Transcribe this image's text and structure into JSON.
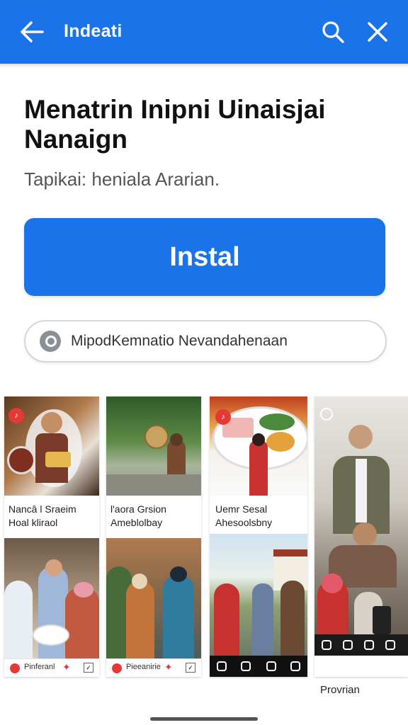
{
  "appbar": {
    "title": "Indeati",
    "back_icon": "arrow-left-icon",
    "search_icon": "search-icon",
    "close_icon": "close-icon",
    "color": "#1a73e8"
  },
  "main": {
    "title": "Menatrin Inipni Uinaisjai Nanaign",
    "subtitle": "Tapikai: heniala Ararian.",
    "install_label": "Instal",
    "search_text": "MipodKemnatio Nevandahenaan"
  },
  "gallery": {
    "cards": [
      {
        "caption_line1": "Nancâ l Sraeim",
        "caption_line2": "Hoal kliraol",
        "badge": "♪"
      },
      {
        "caption_line1": "l'aora Grsion",
        "caption_line2": "Ameblolbay",
        "badge": ""
      },
      {
        "caption_line1": "Uemr Sesal",
        "caption_line2": "Ahesoolsbny",
        "badge": "♪"
      },
      {
        "caption_line1": "Provrian",
        "caption_line2": "",
        "badge": ""
      }
    ],
    "footer_labels": [
      "Pinferanl",
      "Pieeanirie"
    ]
  }
}
